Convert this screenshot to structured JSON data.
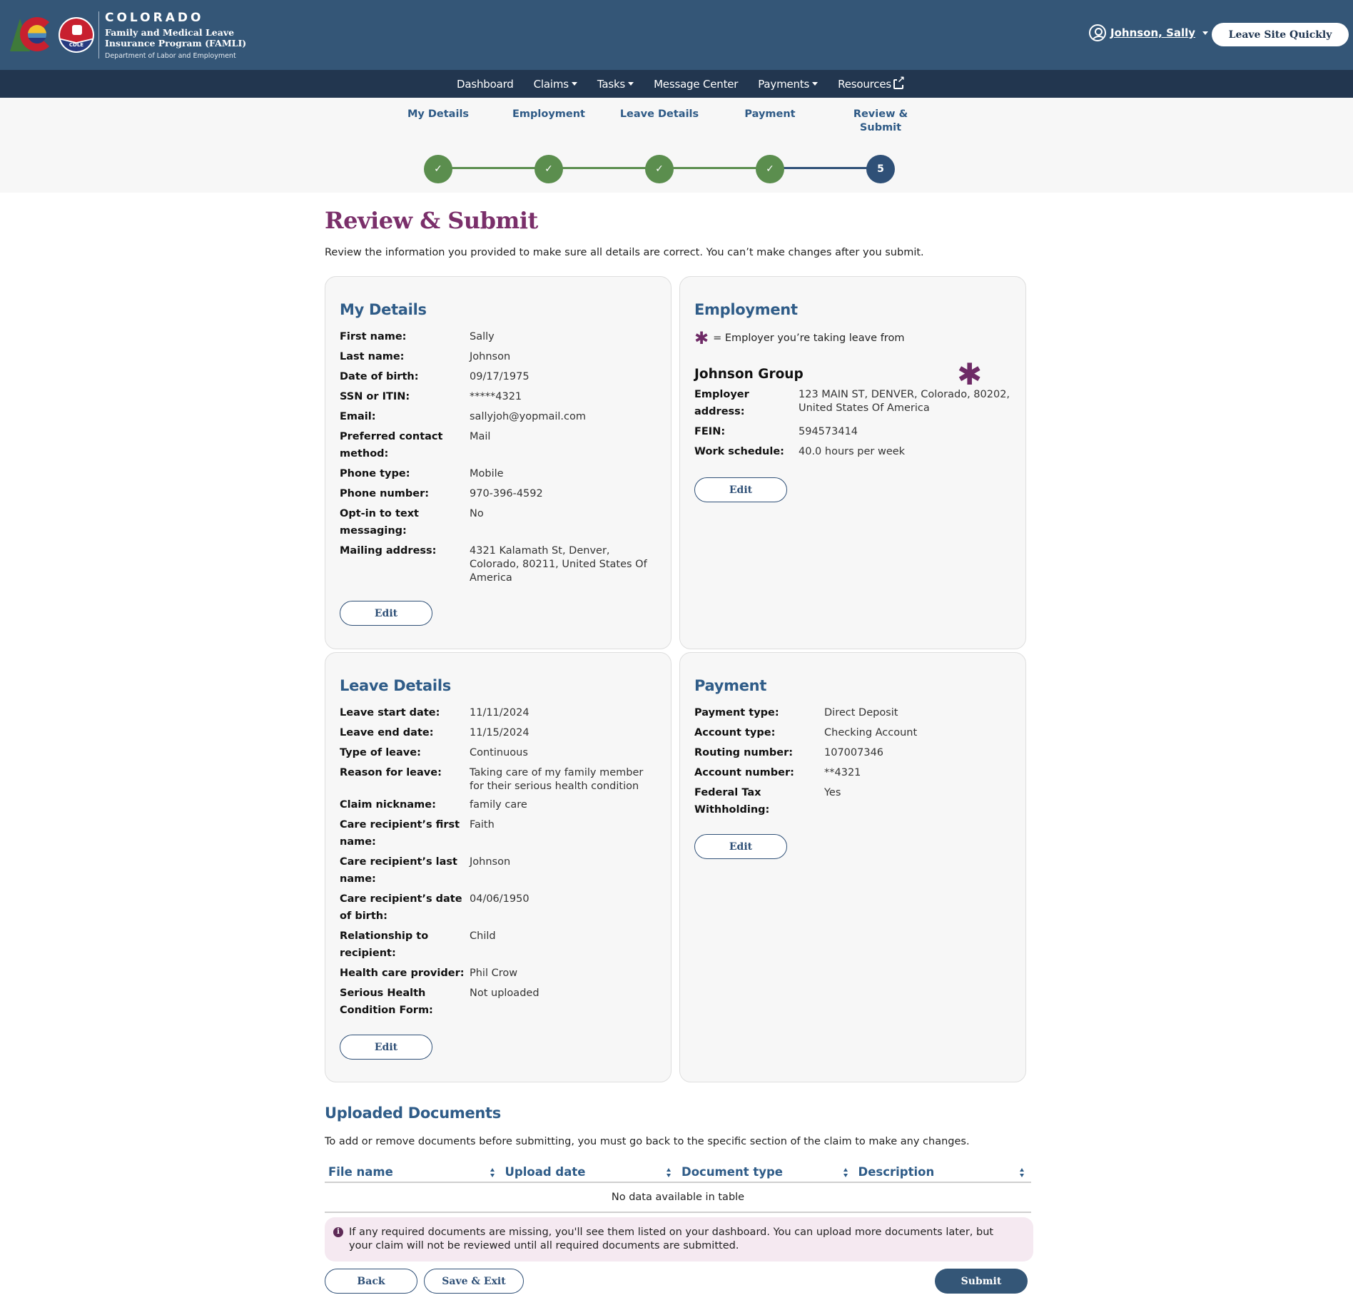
{
  "header": {
    "logo": {
      "state": "COLORADO",
      "program_line1": "Family and Medical Leave",
      "program_line2": "Insurance Program (FAMLI)",
      "department": "Department of Labor and Employment",
      "badge": "CDLE"
    },
    "user_name": "Johnson, Sally",
    "leave_site_label": "Leave Site Quickly"
  },
  "nav": {
    "items": [
      {
        "label": "Dashboard",
        "dropdown": false
      },
      {
        "label": "Claims",
        "dropdown": true
      },
      {
        "label": "Tasks",
        "dropdown": true
      },
      {
        "label": "Message Center",
        "dropdown": false
      },
      {
        "label": "Payments",
        "dropdown": true
      },
      {
        "label": "Resources",
        "dropdown": false,
        "external": true
      }
    ]
  },
  "progress": {
    "steps": [
      {
        "label": "My Details",
        "status": "complete",
        "marker": "✓"
      },
      {
        "label": "Employment",
        "status": "complete",
        "marker": "✓"
      },
      {
        "label": "Leave Details",
        "status": "complete",
        "marker": "✓"
      },
      {
        "label": "Payment",
        "status": "complete",
        "marker": "✓"
      },
      {
        "label": "Review & Submit",
        "status": "current",
        "marker": "5"
      }
    ],
    "colors": {
      "complete": "#5b8e4e",
      "current": "#2f5077"
    }
  },
  "page": {
    "title": "Review & Submit",
    "intro": "Review the information you provided to make sure all details are correct. You can’t make changes after you submit."
  },
  "my_details": {
    "title": "My Details",
    "rows": [
      {
        "label": "First name:",
        "value": "Sally"
      },
      {
        "label": "Last name:",
        "value": "Johnson"
      },
      {
        "label": "Date of birth:",
        "value": "09/17/1975"
      },
      {
        "label": "SSN or ITIN:",
        "value": "*****4321"
      },
      {
        "label": "Email:",
        "value": "sallyjoh@yopmail.com"
      },
      {
        "label": "Preferred contact method:",
        "value": "Mail"
      },
      {
        "label": "Phone type:",
        "value": "Mobile"
      },
      {
        "label": "Phone number:",
        "value": "970-396-4592"
      },
      {
        "label": "Opt-in to text messaging:",
        "value": "No"
      },
      {
        "label": "Mailing address:",
        "value": "4321 Kalamath St, Denver, Colorado, 80211, United States Of America"
      }
    ],
    "edit_label": "Edit"
  },
  "employment": {
    "title": "Employment",
    "legend_symbol": "✱",
    "legend_text": "= Employer you’re taking leave from",
    "employer_name": "Johnson Group",
    "employer_marker": "✱",
    "rows": [
      {
        "label": "Employer address:",
        "value": "123 MAIN ST, DENVER, Colorado, 80202, United States Of America"
      },
      {
        "label": "FEIN:",
        "value": "594573414"
      },
      {
        "label": "Work schedule:",
        "value": "40.0 hours per week"
      }
    ],
    "edit_label": "Edit"
  },
  "leave_details": {
    "title": "Leave Details",
    "rows": [
      {
        "label": "Leave start date:",
        "value": "11/11/2024"
      },
      {
        "label": "Leave end date:",
        "value": "11/15/2024"
      },
      {
        "label": "Type of leave:",
        "value": "Continuous"
      },
      {
        "label": "Reason for leave:",
        "value": "Taking care of my family member for their serious health condition"
      },
      {
        "label": "Claim nickname:",
        "value": "family care"
      },
      {
        "label": "Care recipient’s first name:",
        "value": "Faith"
      },
      {
        "label": "Care recipient’s last name:",
        "value": "Johnson"
      },
      {
        "label": "Care recipient’s date of birth:",
        "value": "04/06/1950"
      },
      {
        "label": "Relationship to recipient:",
        "value": "Child"
      },
      {
        "label": "Health care provider:",
        "value": "Phil Crow"
      },
      {
        "label": "Serious Health Condition Form:",
        "value": "Not uploaded"
      }
    ],
    "edit_label": "Edit"
  },
  "payment": {
    "title": "Payment",
    "rows": [
      {
        "label": "Payment type:",
        "value": "Direct Deposit"
      },
      {
        "label": "Account type:",
        "value": "Checking Account"
      },
      {
        "label": "Routing number:",
        "value": "107007346"
      },
      {
        "label": "Account number:",
        "value": "**4321"
      },
      {
        "label": "Federal Tax Withholding:",
        "value": "Yes"
      }
    ],
    "edit_label": "Edit"
  },
  "documents": {
    "title": "Uploaded Documents",
    "intro": "To add or remove documents before submitting, you must go back to the specific section of the claim to make any changes.",
    "columns": [
      "File name",
      "Upload date",
      "Document type",
      "Description"
    ],
    "empty_text": "No data available in table"
  },
  "notice": {
    "icon": "i",
    "text": "If any required documents are missing, you'll see them listed on your dashboard. You can upload more documents later, but your claim will not be reviewed until all required documents are submitted."
  },
  "actions": {
    "back_label": "Back",
    "save_exit_label": "Save & Exit",
    "submit_label": "Submit"
  }
}
